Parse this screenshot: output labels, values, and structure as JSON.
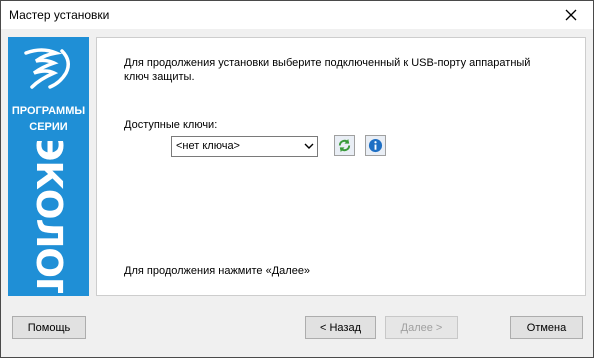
{
  "window": {
    "title": "Мастер установки"
  },
  "banner": {
    "line1": "ПРОГРАММЫ",
    "line2": "СЕРИИ",
    "brand": "ЭКОЛОГ"
  },
  "content": {
    "description": "Для продолжения установки выберите подключенный к USB-порту аппаратный ключ защиты.",
    "available_label": "Доступные ключи:",
    "key_select_value": "<нет ключа>",
    "footer_message": "Для продолжения нажмите «Далее»"
  },
  "buttons": {
    "help": "Помощь",
    "back": "< Назад",
    "next": "Далее >",
    "cancel": "Отмена"
  },
  "icons": {
    "refresh": "refresh-icon",
    "info": "info-icon",
    "close": "close-icon"
  },
  "colors": {
    "banner": "#1f8fd6",
    "info": "#1e6fc4",
    "refresh": "#3a9a3a"
  }
}
